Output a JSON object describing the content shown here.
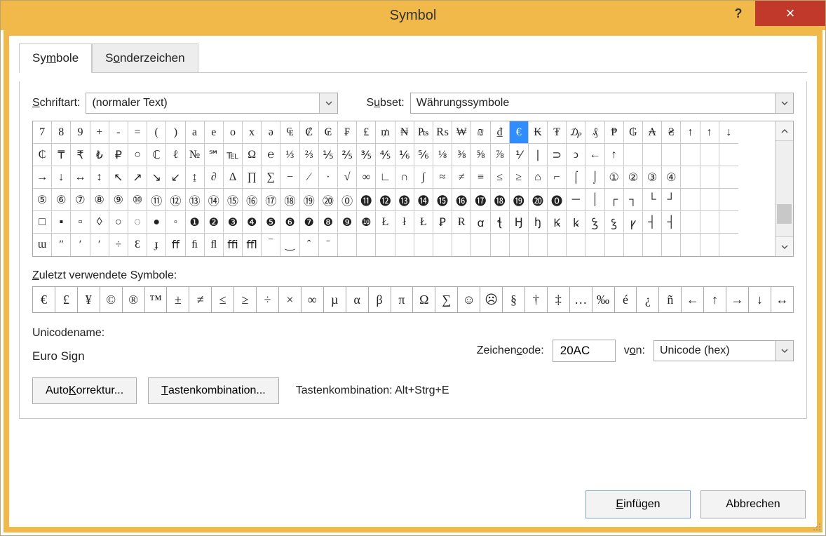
{
  "window": {
    "title": "Symbol",
    "help_icon": "?",
    "close_icon": "×"
  },
  "tabs": {
    "symbols": "Symbole",
    "special": "Sonderzeichen"
  },
  "font": {
    "label_pre": "S",
    "label_post": "chriftart:",
    "value": "(normaler Text)"
  },
  "subset": {
    "label_pre": "S",
    "label_u": "u",
    "label_post": "bset:",
    "value": "Währungssymbole"
  },
  "grid_rows": [
    [
      "7",
      "8",
      "9",
      "+",
      "-",
      "=",
      "(",
      ")",
      "a",
      "e",
      "o",
      "x",
      "ə",
      "₠",
      "₡",
      "₢",
      "₣",
      "₤",
      "₥",
      "₦",
      "₧",
      "₨",
      "₩",
      "₪",
      "₫",
      "€",
      "₭",
      "₮",
      "₯",
      "₰",
      "₱",
      "₲",
      "₳",
      "₴",
      "↑",
      "↑",
      "↓"
    ],
    [
      "₵",
      "₸",
      "₹",
      "₺",
      "₽",
      "○",
      "ℂ",
      "ℓ",
      "№",
      "℠",
      "℡",
      "Ω",
      "℮",
      "⅓",
      "⅔",
      "⅕",
      "⅖",
      "⅗",
      "⅘",
      "⅙",
      "⅚",
      "⅛",
      "⅜",
      "⅝",
      "⅞",
      "⅟",
      "∣",
      "⊃",
      "ↄ",
      "←",
      "↑"
    ],
    [
      "→",
      "↓",
      "↔",
      "↕",
      "↖",
      "↗",
      "↘",
      "↙",
      "↨",
      "∂",
      "Δ",
      "∏",
      "∑",
      "−",
      "∕",
      "∙",
      "√",
      "∞",
      "∟",
      "∩",
      "∫",
      "≈",
      "≠",
      "≡",
      "≤",
      "≥",
      "⌂",
      "⌐",
      "⌠",
      "⌡",
      "①",
      "②",
      "③",
      "④"
    ],
    [
      "⑤",
      "⑥",
      "⑦",
      "⑧",
      "⑨",
      "⑩",
      "⑪",
      "⑫",
      "⑬",
      "⑭",
      "⑮",
      "⑯",
      "⑰",
      "⑱",
      "⑲",
      "⑳",
      "⓪",
      "⓫",
      "⓬",
      "⓭",
      "⓮",
      "⓯",
      "⓰",
      "⓱",
      "⓲",
      "⓳",
      "⓴",
      "⓿",
      "─",
      "│",
      "┌",
      "┐",
      "└",
      "┘"
    ],
    [
      "□",
      "▪",
      "▫",
      "◊",
      "○",
      "◌",
      "●",
      "◦",
      "❶",
      "❷",
      "❸",
      "❹",
      "❺",
      "❻",
      "❼",
      "❽",
      "❾",
      "❿",
      "Ł",
      "ł",
      "Ł",
      "Ꝑ",
      "Ɍ",
      "ꭤ",
      "ꞎ",
      "Ꜧ",
      "ꜧ",
      "Ꝃ",
      "ꝃ",
      "Ꝣ",
      "ꝣ",
      "ꝩ",
      "┤",
      "┤"
    ],
    [
      "ɯ",
      "ʺ",
      "ʹ",
      "ʹ",
      "÷",
      "Ɛ",
      "ɟ",
      "ﬀ",
      "ﬁ",
      "ﬂ",
      "ﬃ",
      "ﬄ",
      "‾",
      "‿",
      "ˆ",
      "ˉ"
    ]
  ],
  "selected_cell": {
    "row": 0,
    "col": 25
  },
  "recent": {
    "label_pre": "Z",
    "label_post": "uletzt verwendete Symbole:",
    "items": [
      "€",
      "£",
      "¥",
      "©",
      "®",
      "™",
      "±",
      "≠",
      "≤",
      "≥",
      "÷",
      "×",
      "∞",
      "µ",
      "α",
      "β",
      "π",
      "Ω",
      "∑",
      "☺",
      "☹",
      "§",
      "†",
      "‡",
      "…",
      "‰",
      "é",
      "¿",
      "ñ",
      "←",
      "↑",
      "→",
      "↓",
      "↔"
    ]
  },
  "unicodename": {
    "label": "Unicodename:",
    "value": "Euro Sign"
  },
  "charcode": {
    "label_pre": "Zeichen",
    "label_u": "c",
    "label_post": "ode:",
    "value": "20AC"
  },
  "from": {
    "label_pre": "v",
    "label_u": "o",
    "label_post": "n:",
    "value": "Unicode (hex)"
  },
  "buttons": {
    "autocorrect_pre": "Auto",
    "autocorrect_u": "K",
    "autocorrect_post": "orrektur...",
    "shortcut_u": "T",
    "shortcut_post": "astenkombination...",
    "shortcut_label": "Tastenkombination: Alt+Strg+E",
    "insert_u": "E",
    "insert_post": "infügen",
    "cancel": "Abbrechen"
  }
}
